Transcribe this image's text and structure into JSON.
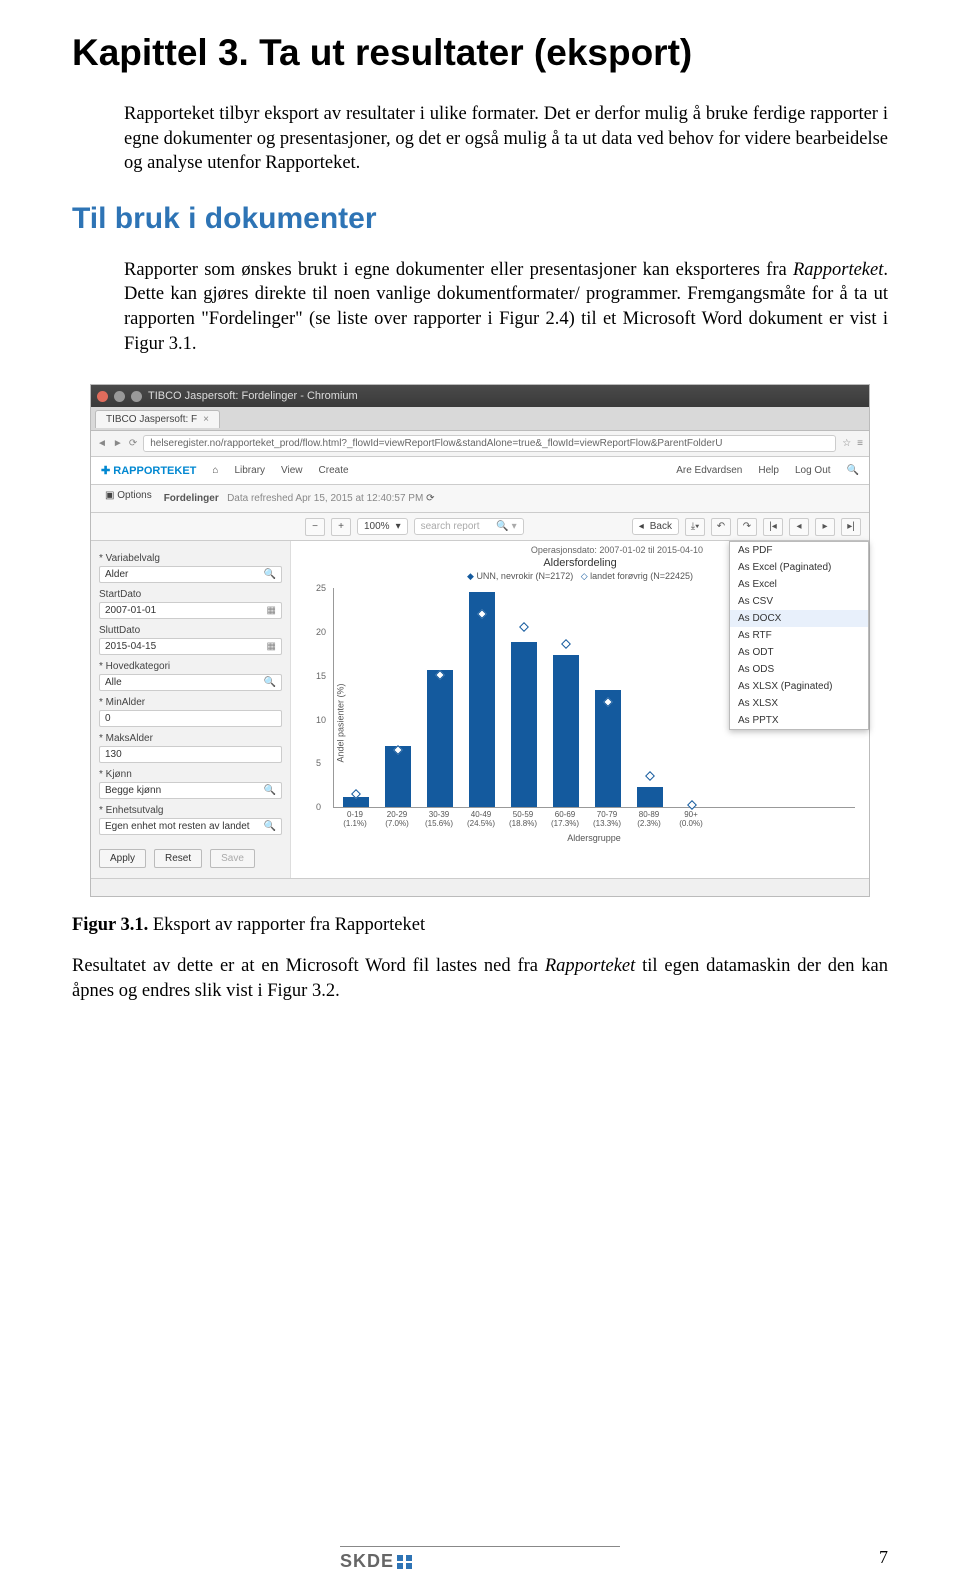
{
  "heading": "Kapittel 3. Ta ut resultater (eksport)",
  "para1": "Rapporteket tilbyr eksport av resultater i ulike formater. Det er derfor mulig å bruke ferdige rapporter i egne dokumenter og presentasjoner, og det er også mulig å ta ut data ved behov for videre bearbeidelse og analyse utenfor Rapporteket.",
  "subheading": "Til bruk i dokumenter",
  "para2a": "Rapporter som ønskes brukt i egne dokumenter eller presentasjoner kan eksporteres fra ",
  "para2b": "Rapporteket",
  "para2c": ". Dette kan gjøres direkte til noen vanlige dokumentformater/ programmer. Fremgangsmåte for å ta ut rapporten \"Fordelinger\" (se liste over rapporter i Figur 2.4) til et Microsoft Word dokument er vist i Figur 3.1.",
  "caption_label": "Figur 3.1.",
  "caption_text": " Eksport av rapporter fra Rapporteket",
  "para3a": "Resultatet av dette er at en Microsoft Word fil lastes ned fra ",
  "para3b": "Rapporteket",
  "para3c": " til egen datamaskin der den kan åpnes og endres slik vist i Figur 3.2.",
  "page_number": "7",
  "footer_logo": "SKDE",
  "screenshot": {
    "window_title": "TIBCO Jaspersoft: Fordelinger - Chromium",
    "tab_title": "TIBCO Jaspersoft: F",
    "url": "helseregister.no/rapporteket_prod/flow.html?_flowId=viewReportFlow&standAlone=true&_flowId=viewReportFlow&ParentFolderU",
    "brand": "RAPPORTEKET",
    "nav_library": "Library",
    "nav_view": "View",
    "nav_create": "Create",
    "user": "Are Edvardsen",
    "help": "Help",
    "logout": "Log Out",
    "options": "Options",
    "crumb": "Fordelinger",
    "refreshed": "Data refreshed Apr 15, 2015 at 12:40:57 PM",
    "zoom": "100%",
    "search_ph": "search report",
    "back": "Back",
    "sidebar": {
      "variabelvalg": "* Variabelvalg",
      "alder": "Alder",
      "startdato_lbl": "StartDato",
      "startdato": "2007-01-01",
      "sluttdato_lbl": "SluttDato",
      "sluttdato": "2015-04-15",
      "hovedkat_lbl": "* Hovedkategori",
      "hovedkat": "Alle",
      "minalder_lbl": "* MinAlder",
      "minalder": "0",
      "maksalder_lbl": "* MaksAlder",
      "maksalder": "130",
      "kjonn_lbl": "* Kjønn",
      "kjonn": "Begge kjønn",
      "enhet_lbl": "* Enhetsutvalg",
      "enhet": "Egen enhet mot resten av landet",
      "apply": "Apply",
      "reset": "Reset",
      "save": "Save"
    },
    "chart": {
      "subline": "Operasjonsdato: 2007-01-02 til 2015-04-10",
      "title": "Aldersfordeling",
      "legend1": "UNN, nevrokir (N=2172)",
      "legend2": "landet forøvrig (N=22425)",
      "ylabel": "Andel pasienter (%)",
      "xlabel": "Aldersgruppe"
    },
    "export_menu": [
      "As PDF",
      "As Excel (Paginated)",
      "As Excel",
      "As CSV",
      "As DOCX",
      "As RTF",
      "As ODT",
      "As ODS",
      "As XLSX (Paginated)",
      "As XLSX",
      "As PPTX"
    ]
  },
  "chart_data": {
    "type": "bar",
    "title": "Aldersfordeling",
    "xlabel": "Aldersgruppe",
    "ylabel": "Andel pasienter (%)",
    "ylim": [
      0,
      25
    ],
    "categories": [
      "0-19",
      "20-29",
      "30-39",
      "40-49",
      "50-59",
      "60-69",
      "70-79",
      "80-89",
      "90+"
    ],
    "series": [
      {
        "name": "UNN, nevrokir (N=2172)",
        "values": [
          1.1,
          7.0,
          15.6,
          24.5,
          18.8,
          17.3,
          13.3,
          2.3,
          0.0
        ]
      },
      {
        "name": "landet forøvrig (N=22425)",
        "values": [
          1.5,
          6.5,
          15.0,
          22.0,
          20.5,
          18.5,
          12.0,
          3.5,
          0.3
        ]
      }
    ],
    "xtick_sub": [
      "(1.1%)",
      "(7.0%)",
      "(15.6%)",
      "(24.5%)",
      "(18.8%)",
      "(17.3%)",
      "(13.3%)",
      "(2.3%)",
      "(0.0%)"
    ]
  }
}
